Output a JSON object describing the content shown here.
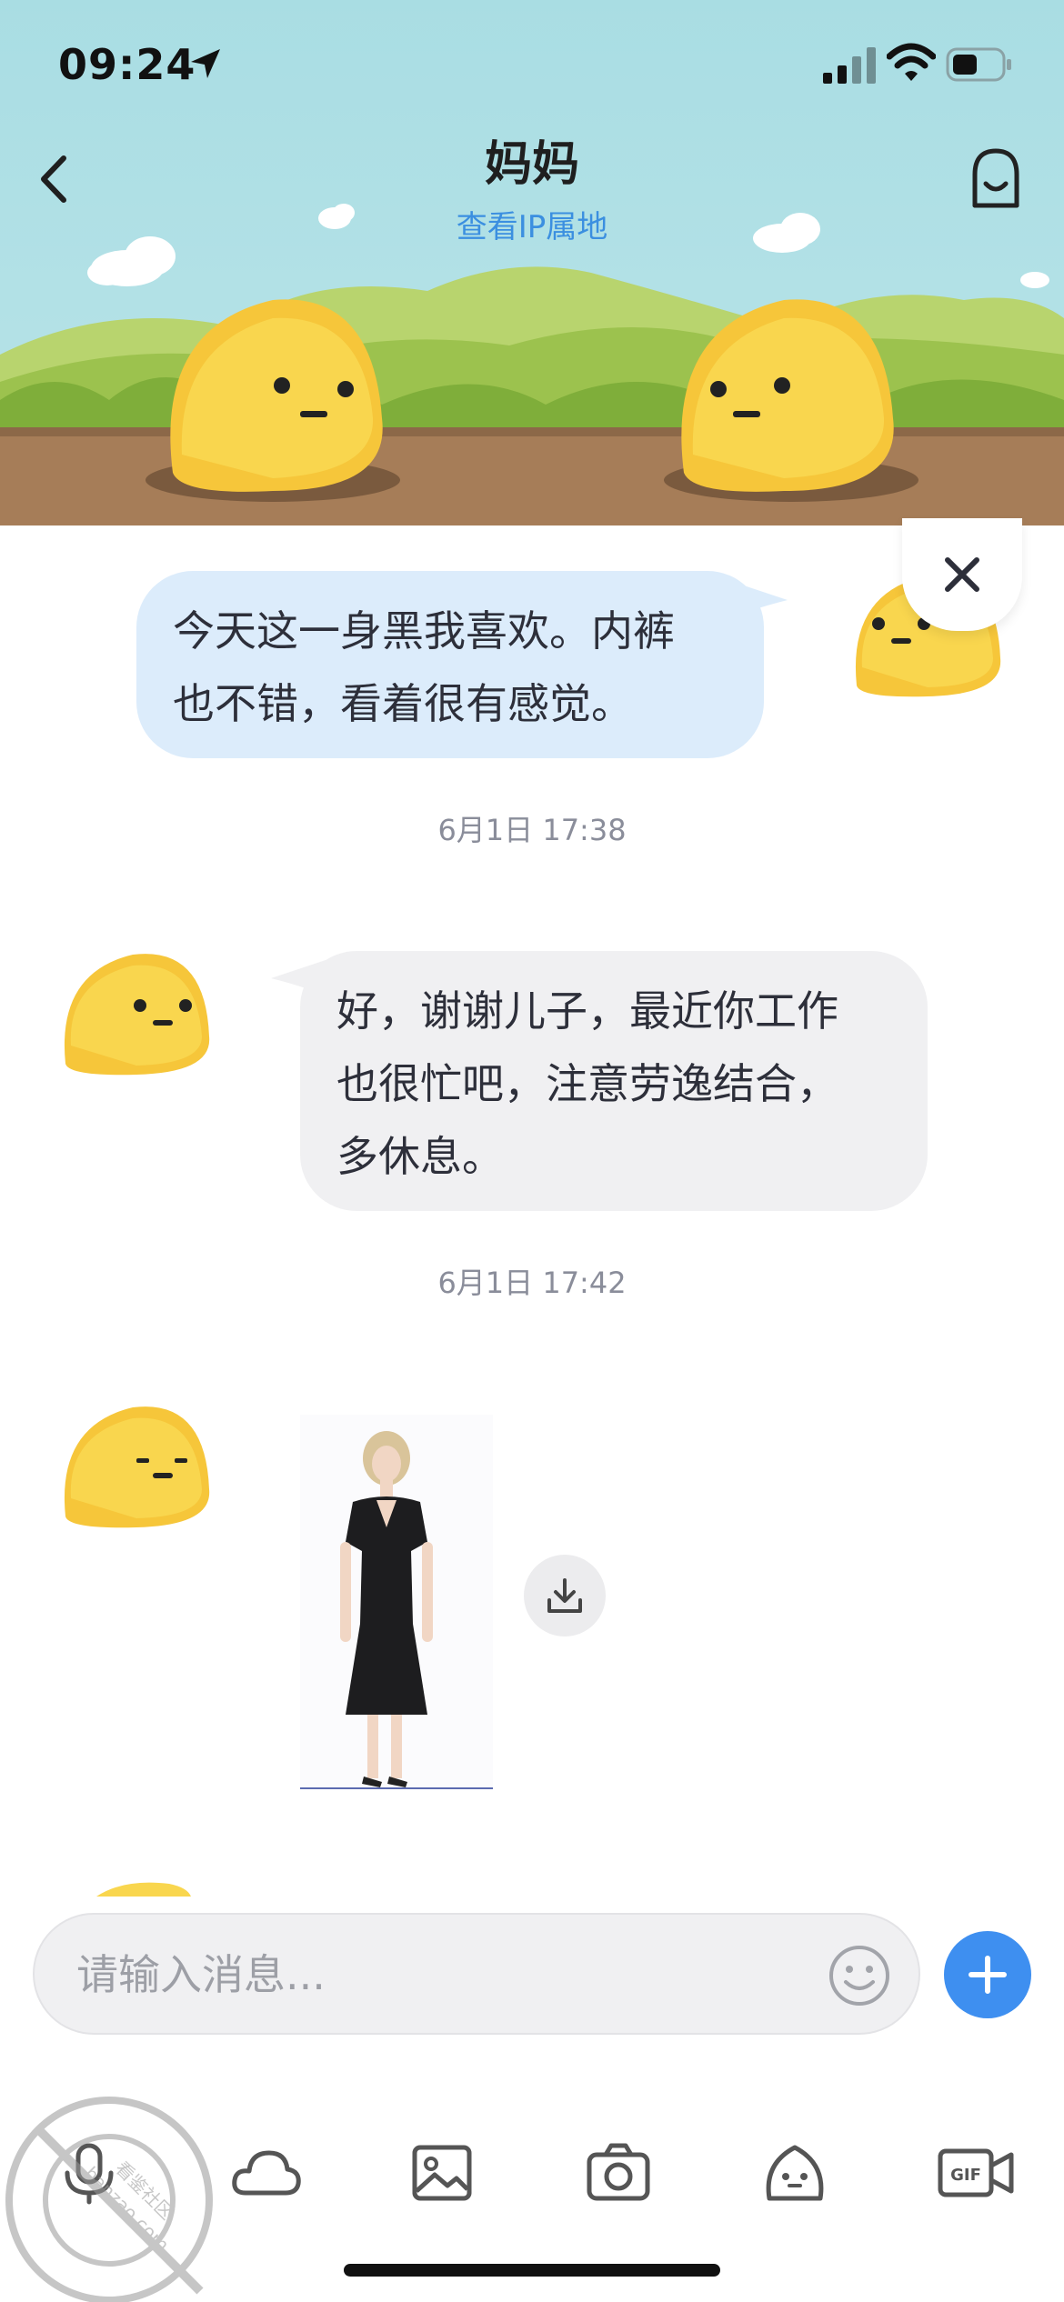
{
  "status_bar": {
    "time": "09:24"
  },
  "header": {
    "title": "妈妈",
    "subtitle": "查看IP属地"
  },
  "messages": [
    {
      "side": "sent",
      "lines": [
        "今天这一身黑我喜欢。内裤",
        "也不错，看着很有感觉。"
      ]
    },
    {
      "timestamp": "6月1日 17:38"
    },
    {
      "side": "received",
      "lines": [
        "好，谢谢儿子，最近你工作",
        "也很忙吧，注意劳逸结合，",
        "多休息。"
      ]
    },
    {
      "timestamp": "6月1日 17:42"
    },
    {
      "side": "received",
      "type": "image",
      "description_icon": "dress-photo"
    }
  ],
  "input": {
    "placeholder": "请输入消息..."
  },
  "toolbar": [
    "voice-icon",
    "cloud-icon",
    "image-icon",
    "camera-icon",
    "sticker-icon",
    "gif-video-icon"
  ],
  "watermark": {
    "text": "hanzao.com",
    "label": "看鉴社区"
  },
  "colors": {
    "sent_bubble": "#dcecfb",
    "received_bubble": "#f0f0f2",
    "accent": "#3e8ff0",
    "header_sky": "#a9dde3"
  }
}
